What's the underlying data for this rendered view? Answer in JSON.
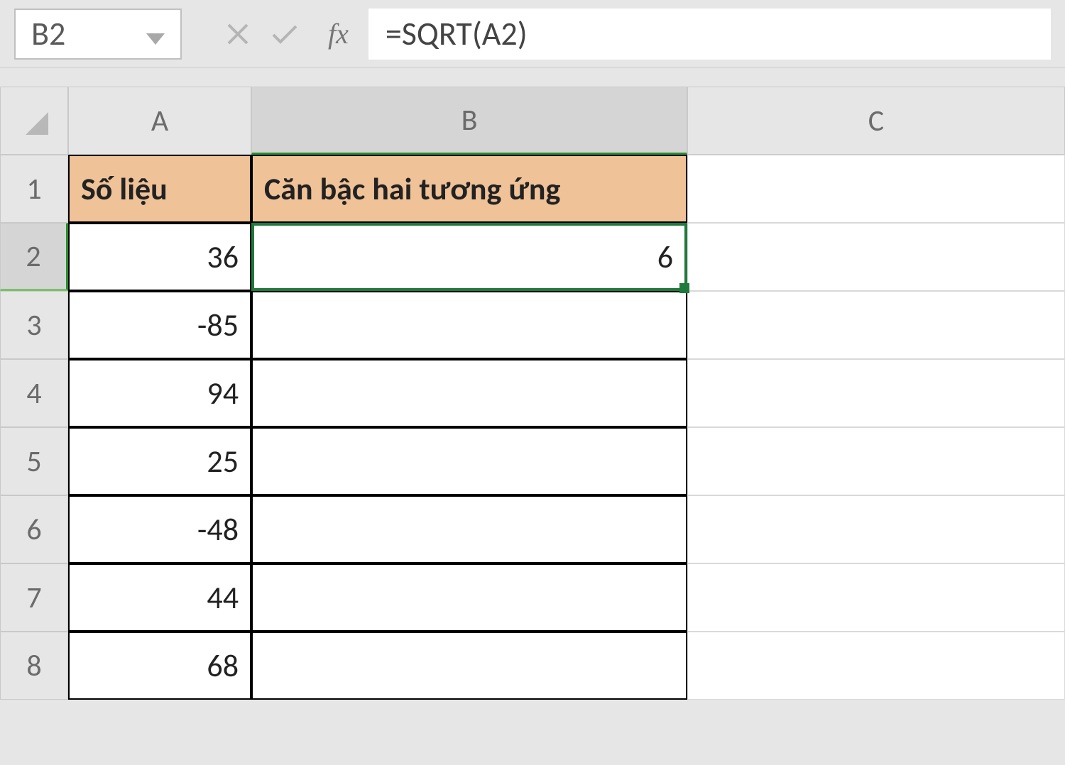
{
  "formula_bar": {
    "cell_ref": "B2",
    "formula": "=SQRT(A2)",
    "fx_label": "fx"
  },
  "columns": [
    "A",
    "B",
    "C"
  ],
  "row_numbers": [
    "1",
    "2",
    "3",
    "4",
    "5",
    "6",
    "7",
    "8"
  ],
  "headers": {
    "A": "Số liệu",
    "B": "Căn bậc hai tương ứng"
  },
  "data": {
    "A": [
      "36",
      "-85",
      "94",
      "25",
      "-48",
      "44",
      "68"
    ],
    "B": [
      "6",
      "",
      "",
      "",
      "",
      "",
      ""
    ]
  },
  "active_cell": "B2"
}
